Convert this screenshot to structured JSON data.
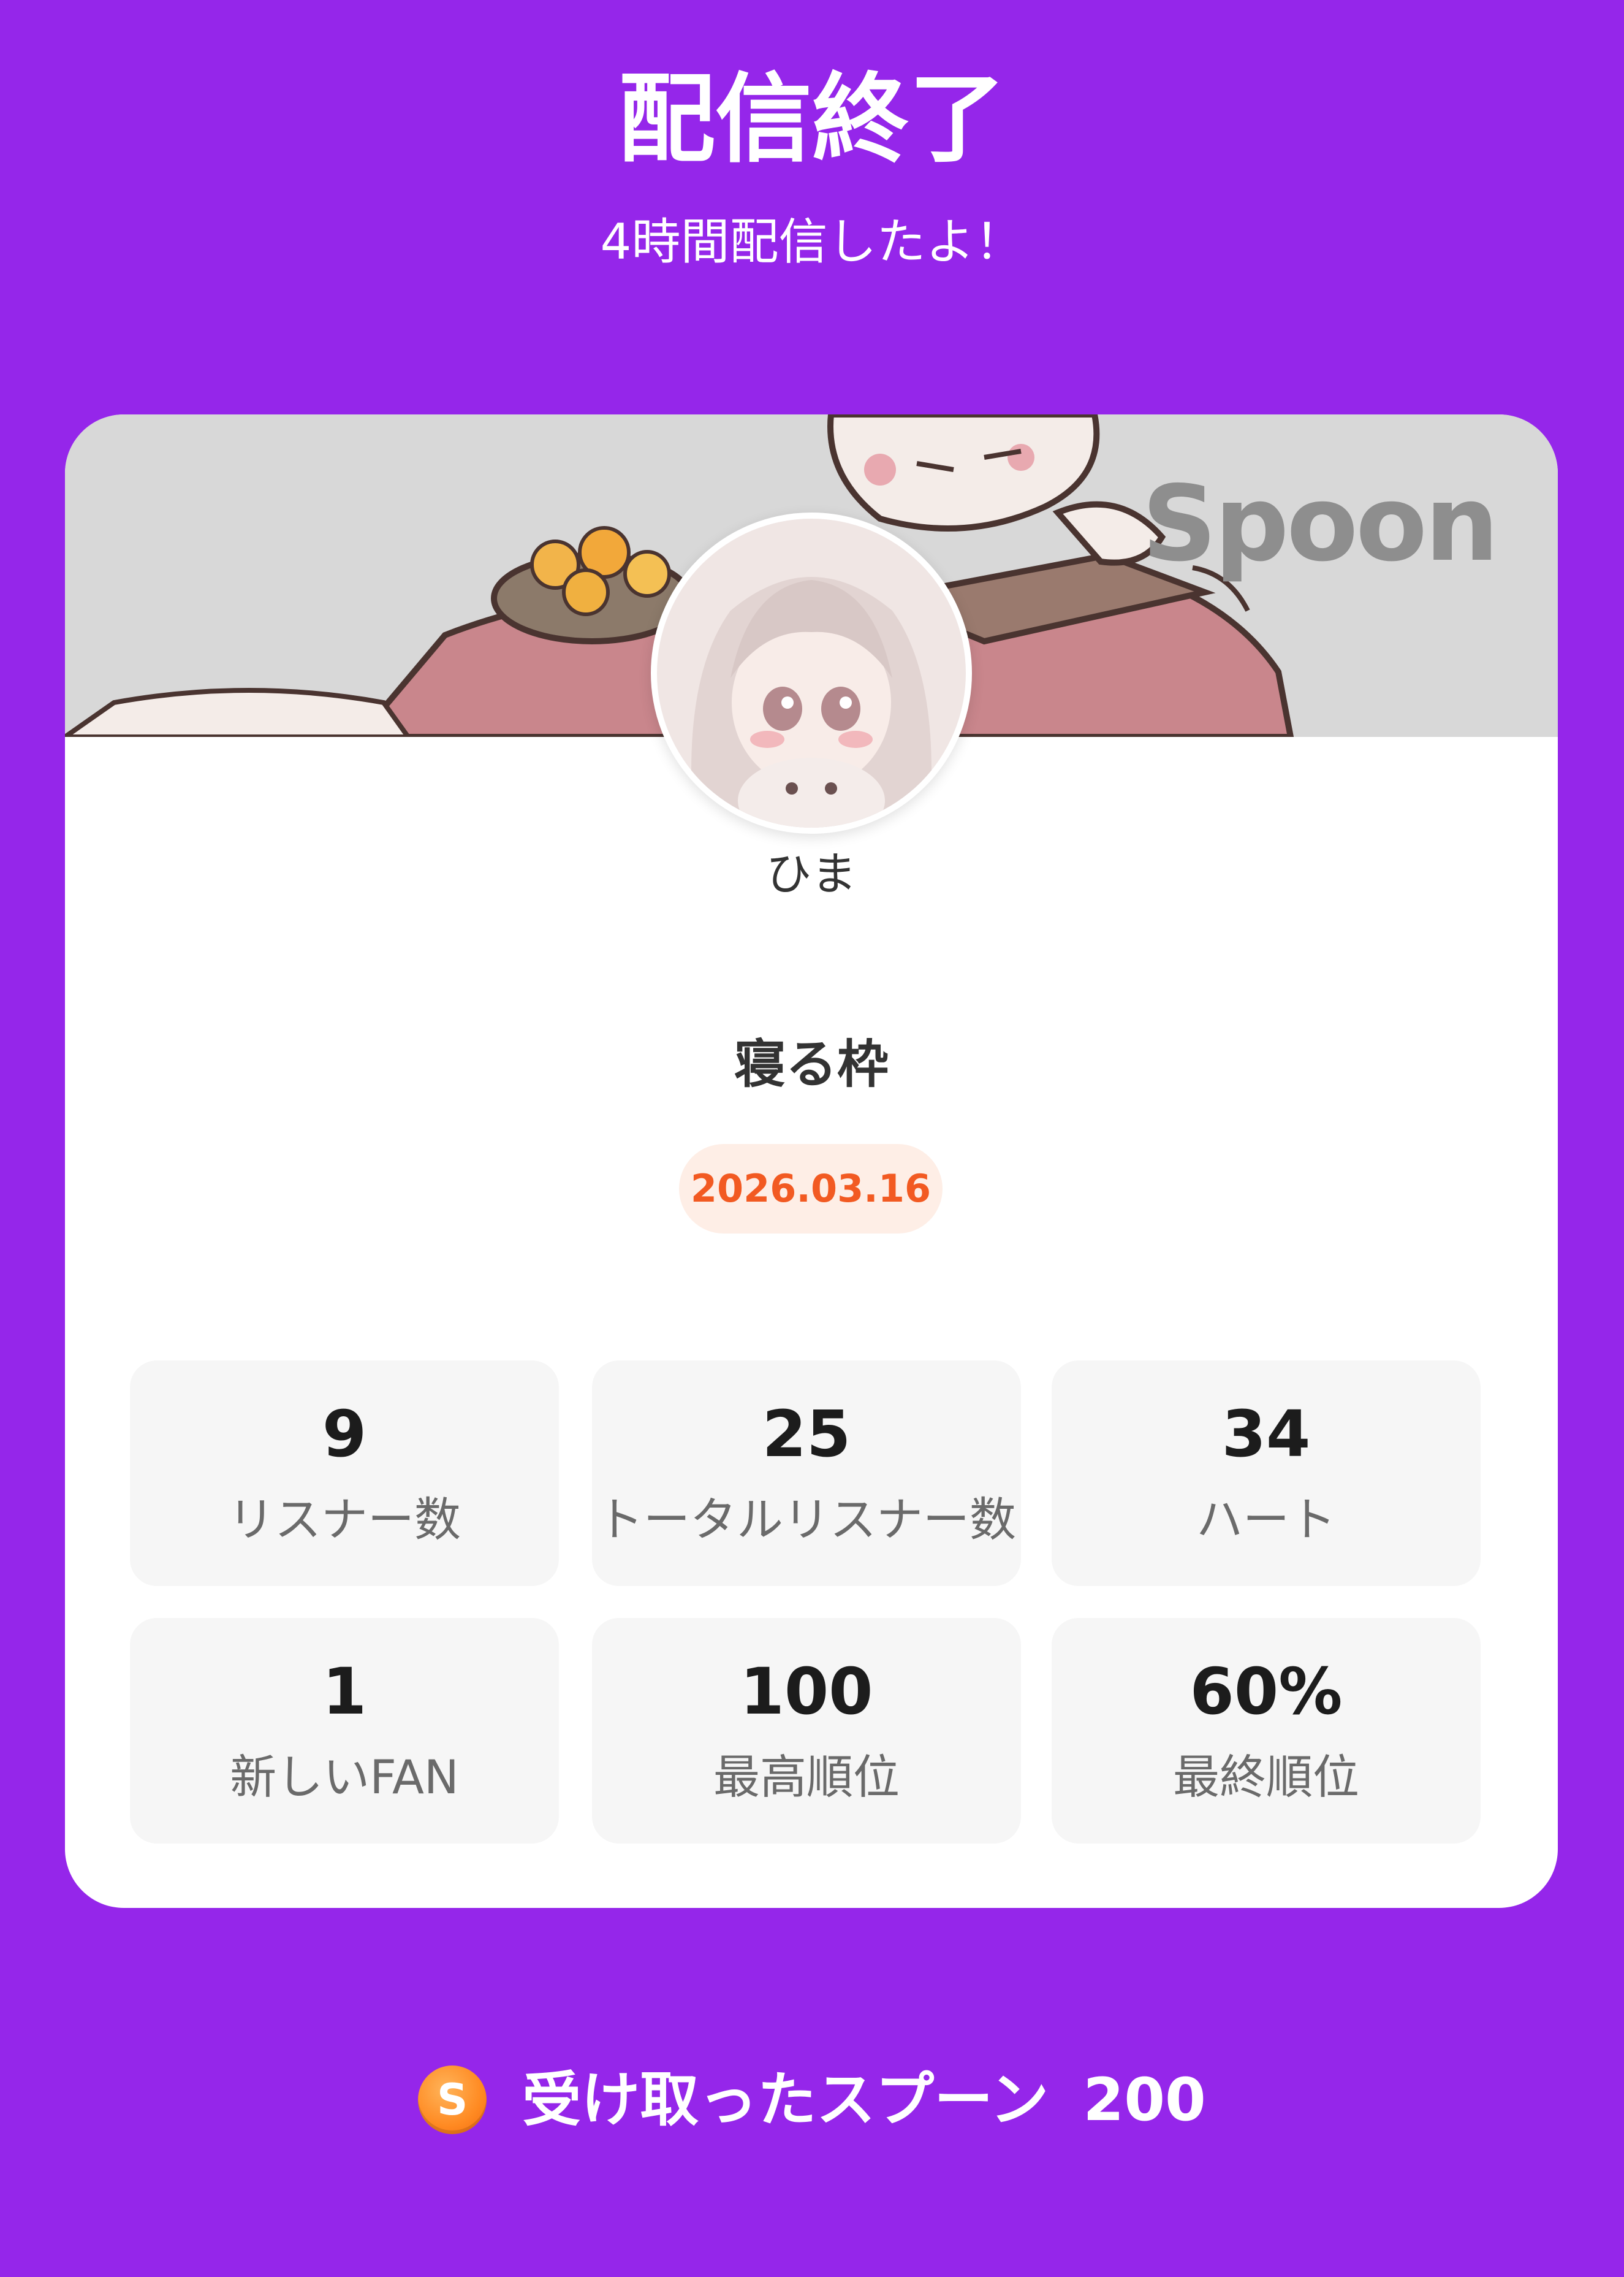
{
  "header": {
    "title": "配信終了",
    "subtitle": "4時間配信したよ！"
  },
  "card": {
    "brand": "Spoon",
    "username": "ひま",
    "live_title": "寝る枠",
    "date": "2026.03.16",
    "stats": [
      {
        "value": "9",
        "label": "リスナー数"
      },
      {
        "value": "25",
        "label": "トータルリスナー数"
      },
      {
        "value": "34",
        "label": "ハート"
      },
      {
        "value": "1",
        "label": "新しいFAN"
      },
      {
        "value": "100",
        "label": "最高順位"
      },
      {
        "value": "60%",
        "label": "最終順位"
      }
    ]
  },
  "footer": {
    "coin_symbol": "S",
    "spoons_label": "受け取ったスプーン",
    "spoons_count": "200"
  },
  "colors": {
    "background": "#9526ea",
    "date_text": "#f25a22",
    "date_bg": "#feeee6"
  }
}
